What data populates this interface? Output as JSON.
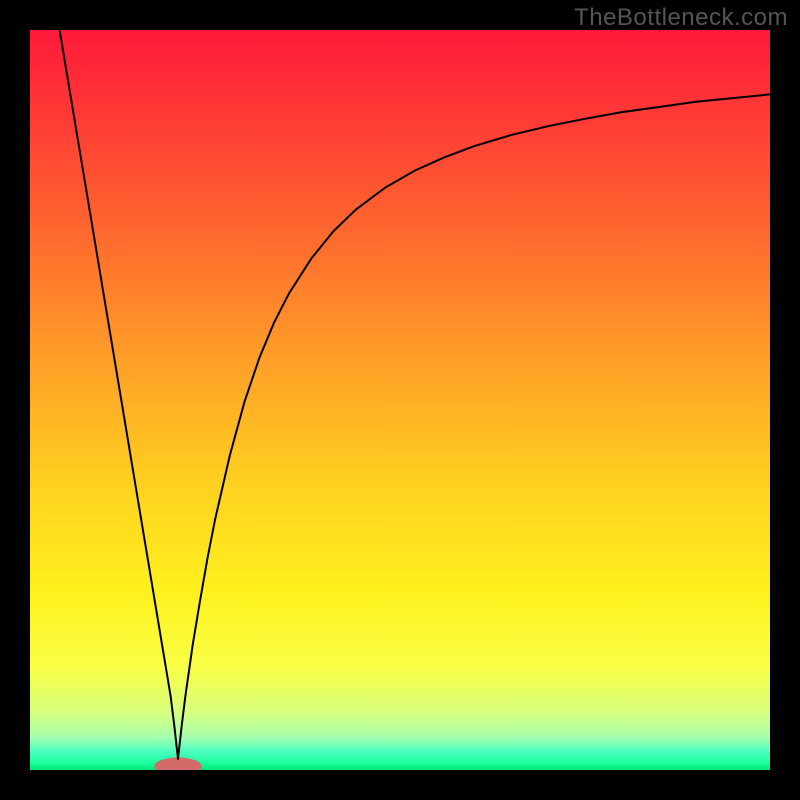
{
  "watermark": "TheBottleneck.com",
  "chart_data": {
    "type": "line",
    "title": "",
    "xlabel": "",
    "ylabel": "",
    "xlim": [
      0,
      100
    ],
    "ylim": [
      0,
      100
    ],
    "grid": false,
    "legend": false,
    "background": {
      "type": "vertical-gradient",
      "stops": [
        {
          "pos": 0.0,
          "color": "#ff1a3a"
        },
        {
          "pos": 0.12,
          "color": "#ff3b36"
        },
        {
          "pos": 0.28,
          "color": "#ff6a2e"
        },
        {
          "pos": 0.45,
          "color": "#ffa028"
        },
        {
          "pos": 0.62,
          "color": "#ffd21f"
        },
        {
          "pos": 0.76,
          "color": "#fff11e"
        },
        {
          "pos": 0.86,
          "color": "#f9ff45"
        },
        {
          "pos": 0.92,
          "color": "#d9ff7a"
        },
        {
          "pos": 0.955,
          "color": "#a8ffad"
        },
        {
          "pos": 0.975,
          "color": "#4dffc0"
        },
        {
          "pos": 0.99,
          "color": "#1effa0"
        },
        {
          "pos": 1.0,
          "color": "#00e676"
        }
      ]
    },
    "minimum_marker": {
      "x": 20,
      "y": 0.5,
      "color": "#d36b6b",
      "rx": 3.2,
      "ry": 1.2
    },
    "series": [
      {
        "name": "curve",
        "color": "#000000",
        "stroke_width": 2,
        "x": [
          4,
          5,
          6,
          7,
          8,
          9,
          10,
          11,
          12,
          13,
          14,
          15,
          16,
          17,
          18,
          19,
          19.5,
          20,
          20.5,
          21,
          22,
          23,
          24,
          25,
          27,
          29,
          31,
          33,
          35,
          38,
          41,
          44,
          48,
          52,
          56,
          60,
          65,
          70,
          75,
          80,
          85,
          90,
          95,
          100
        ],
        "values": [
          100,
          94,
          88,
          82,
          76,
          70,
          64,
          58,
          52,
          46,
          40,
          34,
          28,
          22,
          16,
          10,
          6,
          1.5,
          6,
          10,
          17,
          23,
          28.7,
          33.8,
          42.5,
          49.8,
          55.7,
          60.5,
          64.4,
          69.1,
          72.8,
          75.7,
          78.7,
          81.0,
          82.8,
          84.3,
          85.8,
          87.0,
          88.0,
          88.9,
          89.6,
          90.3,
          90.8,
          91.3
        ]
      }
    ]
  }
}
